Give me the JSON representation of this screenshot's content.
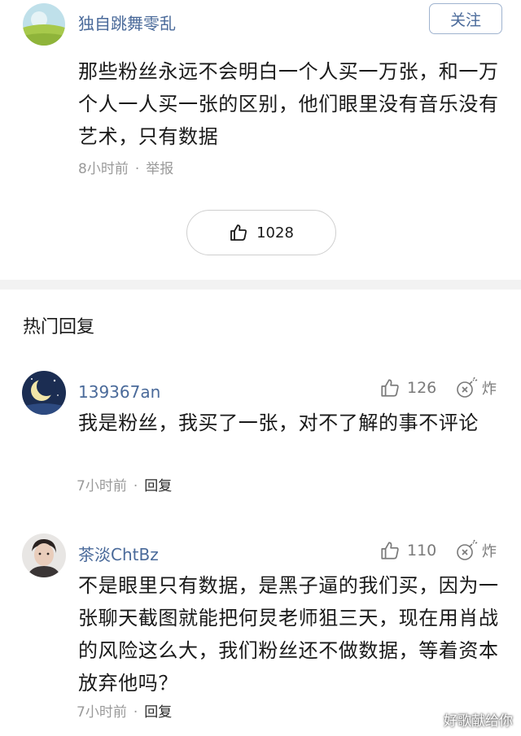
{
  "post": {
    "author": "独自跳舞零乱",
    "follow_label": "关注",
    "body": "那些粉丝永远不会明白一个人买一万张，和一万个人一人买一张的区别，他们眼里没有音乐没有艺术，只有数据",
    "time": "8小时前",
    "dot": "·",
    "report_label": "举报",
    "like_count": "1028"
  },
  "section_title": "热门回复",
  "replies": [
    {
      "username": "139367an",
      "like_count": "126",
      "bomb_label": "炸",
      "text": "我是粉丝，我买了一张，对不了解的事不评论",
      "time": "7小时前",
      "dot": "·",
      "reply_label": "回复"
    },
    {
      "username": "茶淡ChtBz",
      "like_count": "110",
      "bomb_label": "炸",
      "text": "不是眼里只有数据，是黑子逼的我们买，因为一张聊天截图就能把何炅老师狙三天，现在用肖战的风险这么大，我们粉丝还不做数据，等着资本放弃他吗？",
      "time": "7小时前",
      "dot": "·",
      "reply_label": "回复"
    }
  ],
  "watermark": "好歌献给你",
  "colors": {
    "username": "#4a6a9a",
    "meta": "#9a9a9a",
    "divider": "#f2f2f2"
  }
}
